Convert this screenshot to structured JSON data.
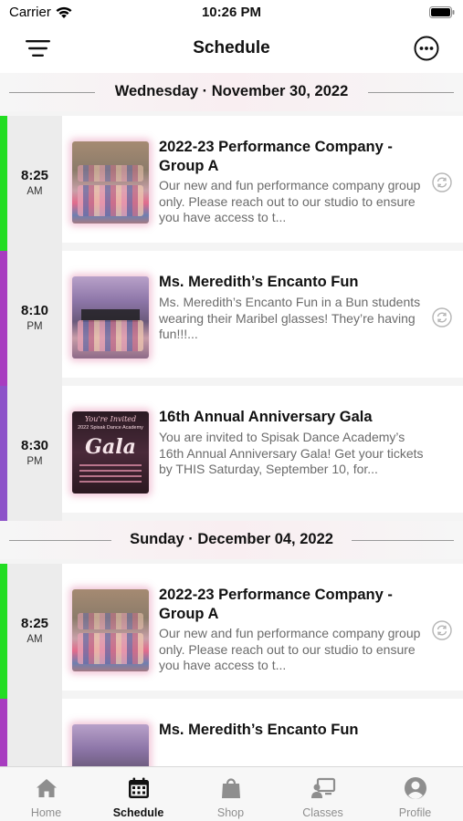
{
  "status_bar": {
    "carrier": "Carrier",
    "time": "10:26 PM"
  },
  "nav": {
    "title": "Schedule",
    "menu_icon": "hamburger-menu-icon",
    "more_icon": "more-options-icon"
  },
  "sections": [
    {
      "date_label": "Wednesday · November 30, 2022",
      "events": [
        {
          "time": "8:25",
          "ampm": "AM",
          "color": "#22dd22",
          "title": "2022-23 Performance Company - Group A",
          "description": "Our new and fun performance company group only. Please reach out to our studio to ensure you have access to t..."
        },
        {
          "time": "8:10",
          "ampm": "PM",
          "color": "#a83cc0",
          "title": "Ms. Meredith’s Encanto Fun",
          "description": "Ms. Meredith’s Encanto Fun in a Bun students wearing their Maribel glasses! They’re having fun!!!..."
        },
        {
          "time": "8:30",
          "ampm": "PM",
          "color": "#8d52c9",
          "title": "16th Annual Anniversary Gala",
          "description": "You are invited to Spisak Dance Academy’s 16th Annual Anniversary Gala! Get your tickets by THIS Saturday, September 10, for...",
          "image_text": {
            "top": "You're Invited",
            "sub": "2022 Spisak Dance Academy",
            "word": "Gala"
          }
        }
      ]
    },
    {
      "date_label": "Sunday · December 04, 2022",
      "events": [
        {
          "time": "8:25",
          "ampm": "AM",
          "color": "#22dd22",
          "title": "2022-23 Performance Company - Group A",
          "description": "Our new and fun performance company group only. Please reach out to our studio to ensure you have access to t..."
        },
        {
          "time": "",
          "ampm": "",
          "color": "#a83cc0",
          "title": "Ms. Meredith’s Encanto Fun",
          "description": ""
        }
      ]
    }
  ],
  "tab_bar": {
    "tabs": [
      {
        "label": "Home",
        "icon": "home-icon",
        "active": false
      },
      {
        "label": "Schedule",
        "icon": "calendar-icon",
        "active": true
      },
      {
        "label": "Shop",
        "icon": "shopping-bag-icon",
        "active": false
      },
      {
        "label": "Classes",
        "icon": "classes-icon",
        "active": false
      },
      {
        "label": "Profile",
        "icon": "profile-icon",
        "active": false
      }
    ]
  }
}
